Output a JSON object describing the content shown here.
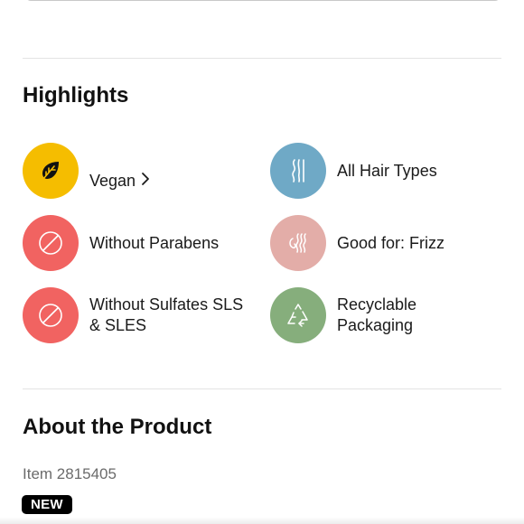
{
  "highlights": {
    "title": "Highlights",
    "items": [
      {
        "label": "Vegan",
        "icon": "leaf-icon",
        "color": "#F5BD00",
        "has_link": true
      },
      {
        "label": "All Hair Types",
        "icon": "hair-strands-icon",
        "color": "#6FA9C6"
      },
      {
        "label": "Without Parabens",
        "icon": "prohibited-icon",
        "color": "#F16361"
      },
      {
        "label": "Good for: Frizz",
        "icon": "frizz-hair-icon",
        "color": "#E3ADA8"
      },
      {
        "label": "Without Sulfates SLS\n& SLES",
        "icon": "prohibited-icon",
        "color": "#F16361"
      },
      {
        "label": "Recyclable\nPackaging",
        "icon": "recycle-icon",
        "color": "#86AE7C"
      }
    ]
  },
  "about": {
    "title": "About the Product",
    "item_number": "Item 2815405",
    "badge": "NEW"
  },
  "colors": {
    "divider": "#E3E3E3",
    "badge_bg": "#000000"
  }
}
